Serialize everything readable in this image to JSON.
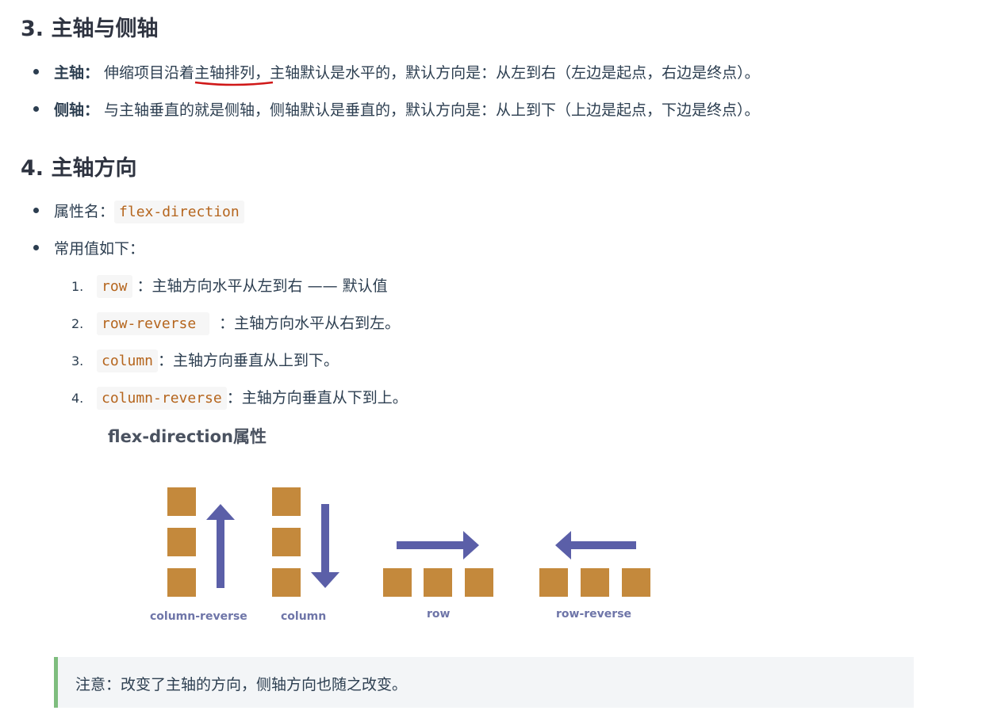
{
  "sections": [
    {
      "heading": "3. 主轴与侧轴"
    },
    {
      "heading": "4. 主轴方向"
    }
  ],
  "axis_bullets": [
    {
      "term": "主轴：",
      "text_before": " 伸缩项目沿着",
      "underlined": "主轴排列",
      "text_after": "，主轴默认是水平的，默认方向是：从左到右（左边是起点，右边是终点）。"
    },
    {
      "term": "侧轴：",
      "text": " 与主轴垂直的就是侧轴，侧轴默认是垂直的，默认方向是：从上到下（上边是起点，下边是终点）。"
    }
  ],
  "direction_bullets": [
    {
      "label": "属性名：",
      "code": "flex-direction"
    },
    {
      "label": "常用值如下："
    }
  ],
  "values": [
    {
      "num": "1.",
      "code": "row",
      "desc": " ：主轴方向水平从左到右 —— 默认值"
    },
    {
      "num": "2.",
      "code": "row-reverse ",
      "desc": "  ：主轴方向水平从右到左。"
    },
    {
      "num": "3.",
      "code": "column",
      "desc": "：主轴方向垂直从上到下。"
    },
    {
      "num": "4.",
      "code": "column-reverse",
      "desc": "：主轴方向垂直从下到上。"
    }
  ],
  "figure": {
    "title": "flex-direction属性",
    "captions": {
      "column_reverse": "column-reverse",
      "column": "column",
      "row": "row",
      "row_reverse": "row-reverse"
    },
    "colors": {
      "box": "#c4893c",
      "arrow": "#5b5fa8",
      "caption": "#6e75a8",
      "underline": "#d01818"
    }
  },
  "tip": {
    "text": "注意：改变了主轴的方向，侧轴方向也随之改变。",
    "border_color": "#7ebd7e"
  }
}
